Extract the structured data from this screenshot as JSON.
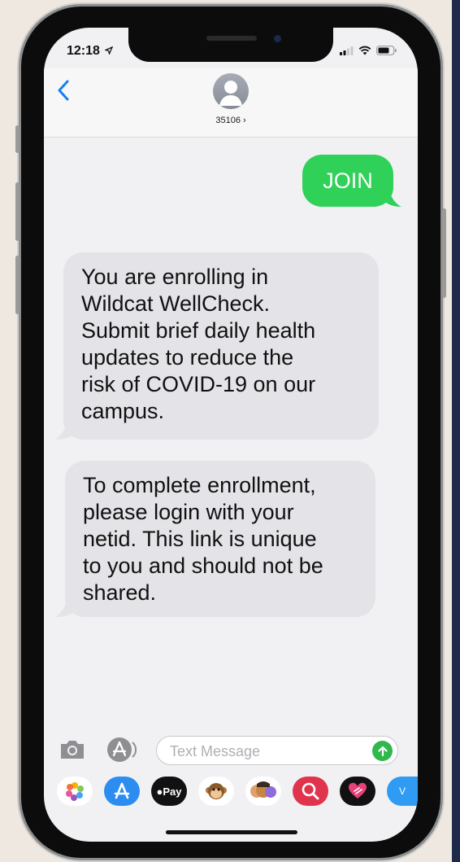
{
  "status_bar": {
    "time": "12:18"
  },
  "header": {
    "contact": "35106 ›",
    "back_label": "‹"
  },
  "messages": [
    {
      "direction": "outgoing",
      "text": "JOIN"
    },
    {
      "direction": "incoming",
      "lines": [
        "You are enrolling in",
        "Wildcat WellCheck.",
        "Submit brief daily health",
        "updates to reduce the",
        "risk of COVID-19 on our",
        "campus."
      ]
    },
    {
      "direction": "incoming",
      "lines": [
        "To complete enrollment,",
        "please login with your",
        "netid. This link is unique",
        "to you and should not be",
        "shared."
      ]
    }
  ],
  "composer": {
    "placeholder": "Text Message"
  },
  "app_drawer": {
    "apps": [
      "photos-icon",
      "app-store-icon",
      "apple-pay-icon",
      "monkey-memoji-icon",
      "memoji-icon",
      "search-images-icon",
      "digital-touch-icon",
      "more-apps-icon"
    ],
    "apple_pay_label": "Pay"
  },
  "colors": {
    "bubble_out": "#2fd158",
    "bubble_in": "#e4e4e8",
    "accent": "#147efb"
  }
}
